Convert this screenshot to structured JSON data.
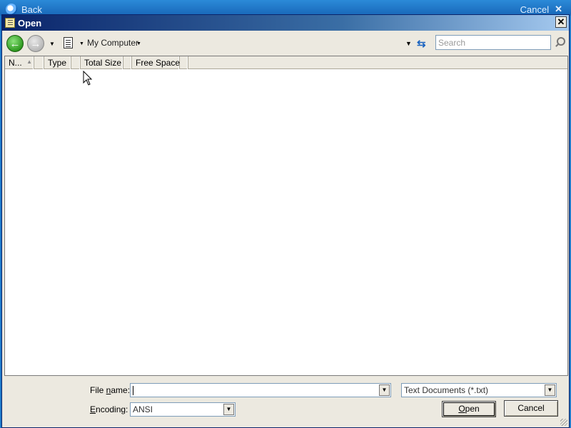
{
  "background": {
    "back_label": "Back",
    "cancel_label": "Cancel",
    "close_glyph": "✕"
  },
  "dialog": {
    "title": "Open",
    "close_glyph": "✕"
  },
  "toolbar": {
    "back_icon": "arrow-left-icon",
    "forward_icon": "arrow-right-icon",
    "breadcrumb": "My Computer",
    "search_placeholder": "Search"
  },
  "columns": [
    {
      "label": "N..."
    },
    {
      "label": ""
    },
    {
      "label": "Type"
    },
    {
      "label": ""
    },
    {
      "label": "Total Size"
    },
    {
      "label": ""
    },
    {
      "label": "Free Space"
    },
    {
      "label": ""
    }
  ],
  "file_name": {
    "label_prefix": "File ",
    "label_hotkey": "n",
    "label_suffix": "ame:",
    "value": ""
  },
  "file_type": {
    "selected": "Text Documents (*.txt)"
  },
  "encoding": {
    "label_hotkey": "E",
    "label_suffix": "ncoding:",
    "selected": "ANSI"
  },
  "buttons": {
    "open_hotkey": "O",
    "open_suffix": "pen",
    "cancel": "Cancel"
  }
}
